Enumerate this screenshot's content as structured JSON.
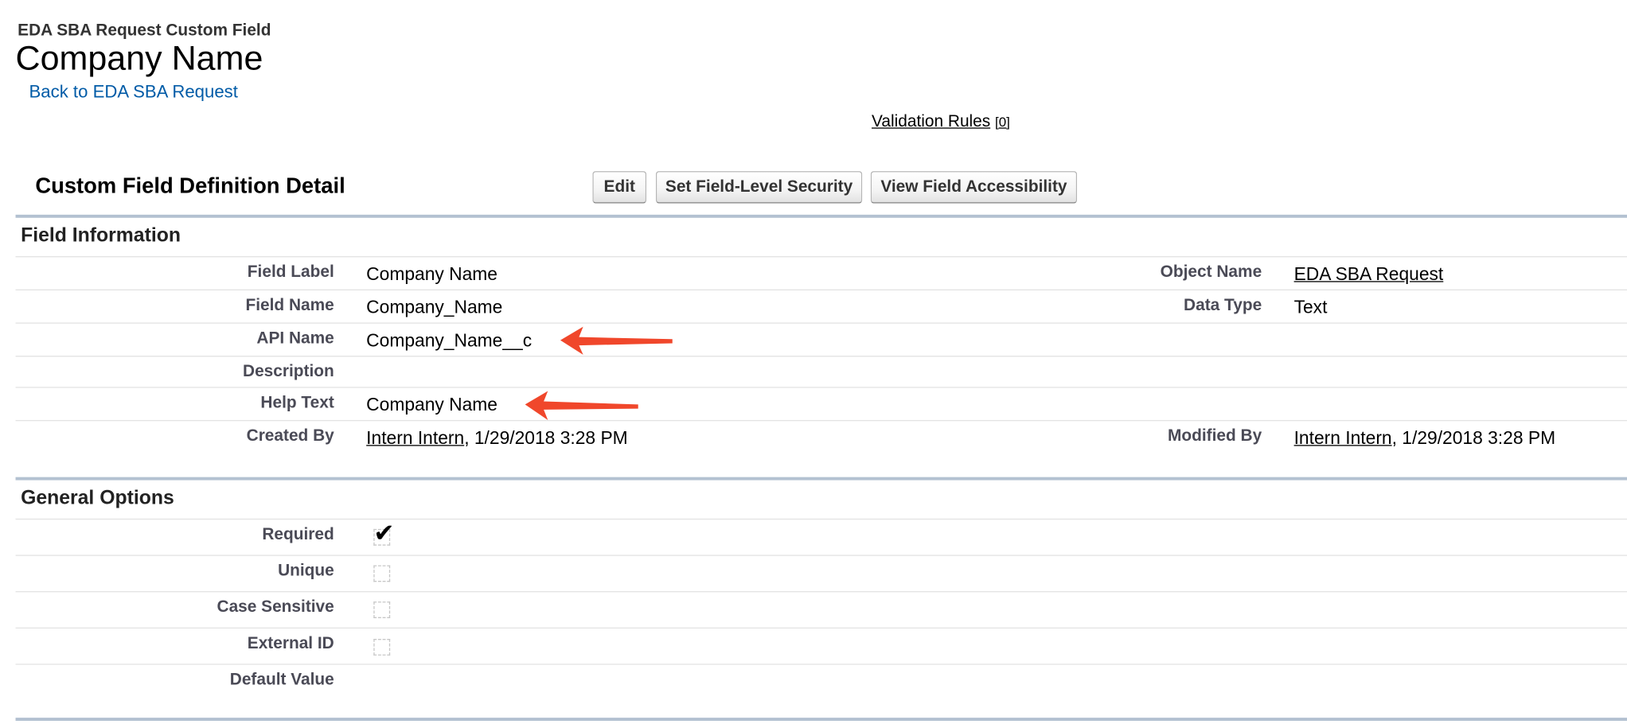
{
  "header": {
    "object_type": "EDA SBA Request Custom Field",
    "title": "Company Name",
    "back_link": "Back to EDA SBA Request"
  },
  "related": {
    "validation_rules_label": "Validation Rules",
    "validation_rules_count": "[0]"
  },
  "detail": {
    "section_title": "Custom Field Definition Detail",
    "buttons": {
      "edit": "Edit",
      "field_level_security": "Set Field-Level Security",
      "view_accessibility": "View Field Accessibility"
    }
  },
  "field_information": {
    "title": "Field Information",
    "field_label": {
      "label": "Field Label",
      "value": "Company Name"
    },
    "field_name": {
      "label": "Field Name",
      "value": "Company_Name"
    },
    "api_name": {
      "label": "API Name",
      "value": "Company_Name__c"
    },
    "description": {
      "label": "Description",
      "value": ""
    },
    "help_text": {
      "label": "Help Text",
      "value": "Company Name"
    },
    "created_by": {
      "label": "Created By",
      "user": "Intern Intern",
      "date": ", 1/29/2018 3:28 PM"
    },
    "object_name": {
      "label": "Object Name",
      "value": "EDA SBA Request"
    },
    "data_type": {
      "label": "Data Type",
      "value": "Text"
    },
    "modified_by": {
      "label": "Modified By",
      "user": "Intern Intern",
      "date": ", 1/29/2018 3:28 PM"
    }
  },
  "general_options": {
    "title": "General Options",
    "required": {
      "label": "Required",
      "checked": true
    },
    "unique": {
      "label": "Unique",
      "checked": false
    },
    "case_sensitive": {
      "label": "Case Sensitive",
      "checked": false
    },
    "external_id": {
      "label": "External ID",
      "checked": false
    },
    "default_value": {
      "label": "Default Value",
      "value": ""
    }
  },
  "annotation_color": "#f0472b"
}
